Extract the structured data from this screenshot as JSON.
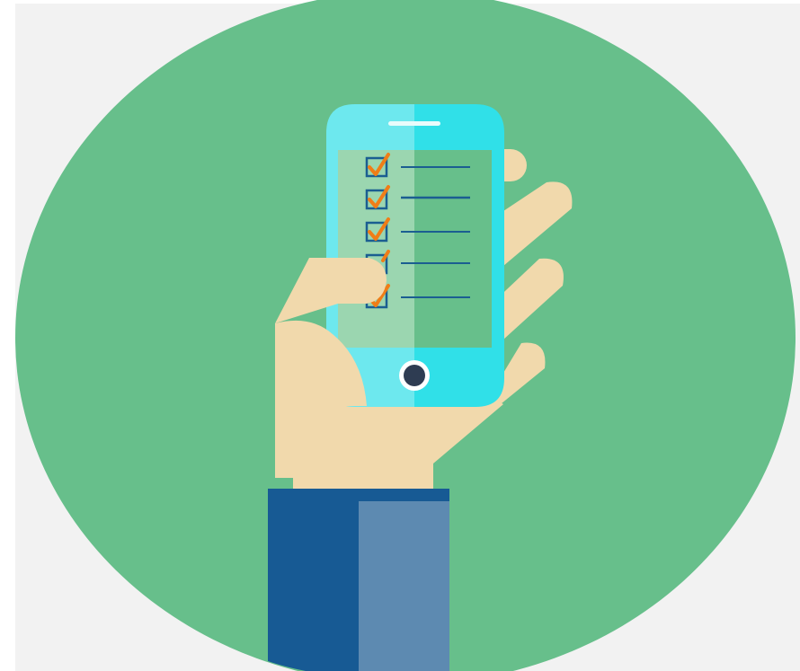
{
  "illustration": {
    "subject": "hand-holding-smartphone-with-checklist",
    "colors": {
      "background": "#f2f2f2",
      "circle": "#67bf8b",
      "phone_light": "#6de8ee",
      "phone_dark": "#30e0e8",
      "screen_light": "#9bd6b0",
      "screen_dark": "#67bf8b",
      "skin": "#f1d9ac",
      "sleeve_dark": "#175a94",
      "sleeve_light": "#5d8ab1",
      "checkbox": "#1b5e91",
      "checkmark": "#f07d17",
      "home_button": "#2e3c52"
    },
    "checklist": {
      "items": [
        {
          "checked": true
        },
        {
          "checked": true
        },
        {
          "checked": true
        },
        {
          "checked": false
        },
        {
          "checked": true
        }
      ]
    }
  }
}
